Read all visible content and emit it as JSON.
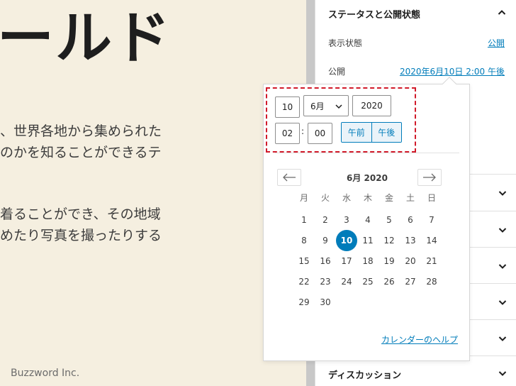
{
  "canvas": {
    "heading": "ールド",
    "paragraph1": [
      "、世界各地から集められた",
      "のかを知ることができるテ"
    ],
    "paragraph2": [
      "着ることができ、その地域",
      "めたり写真を撮ったりする"
    ],
    "footer_brand": "Buzzword Inc."
  },
  "sidebar": {
    "status_header": "ステータスと公開状態",
    "visibility_label": "表示状態",
    "visibility_value": "公開",
    "publish_label": "公開",
    "publish_value": "2020年6月10日 2:00 午後",
    "discussion_label": "ディスカッション"
  },
  "datepicker": {
    "day": "10",
    "month": "6月",
    "year": "2020",
    "hour": "02",
    "minute": "00",
    "colon": ":",
    "am_label": "午前",
    "pm_label": "午後",
    "month_title": "6月 2020",
    "weekdays": [
      "月",
      "火",
      "水",
      "木",
      "金",
      "土",
      "日"
    ],
    "weeks": [
      [
        "1",
        "2",
        "3",
        "4",
        "5",
        "6",
        "7"
      ],
      [
        "8",
        "9",
        "10",
        "11",
        "12",
        "13",
        "14"
      ],
      [
        "15",
        "16",
        "17",
        "18",
        "19",
        "20",
        "21"
      ],
      [
        "22",
        "23",
        "24",
        "25",
        "26",
        "27",
        "28"
      ],
      [
        "29",
        "30"
      ]
    ],
    "selected_day": "10",
    "help_link": "カレンダーのヘルプ"
  },
  "colors": {
    "accent": "#007cba",
    "highlight": "#d11a2a",
    "canvas_bg": "#f5efe0"
  },
  "icons": {
    "status_toggle": "chevron-up-icon",
    "panel_toggle": "chevron-down-icon",
    "prev_month": "arrow-left-icon",
    "next_month": "arrow-right-icon"
  }
}
